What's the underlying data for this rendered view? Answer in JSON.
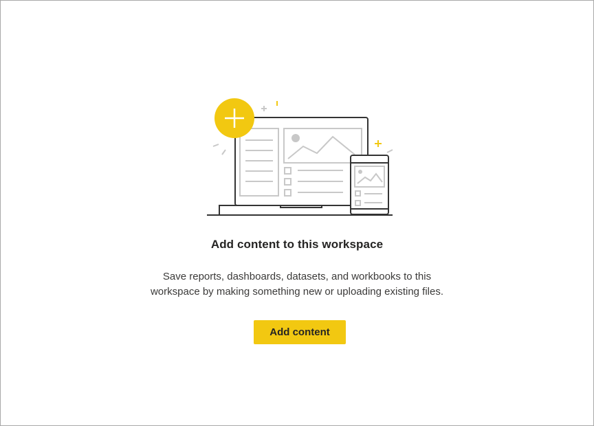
{
  "empty_state": {
    "title": "Add content to this workspace",
    "description_line1": "Save reports, dashboards, datasets, and workbooks to this",
    "description_line2": "workspace by making something new or uploading existing files.",
    "button_label": "Add content"
  },
  "colors": {
    "accent": "#f2c811",
    "outline": "#333333",
    "muted": "#c8c8c8",
    "border": "#a8a8a8"
  },
  "icons": [
    "plus-icon",
    "laptop-icon",
    "phone-icon"
  ]
}
